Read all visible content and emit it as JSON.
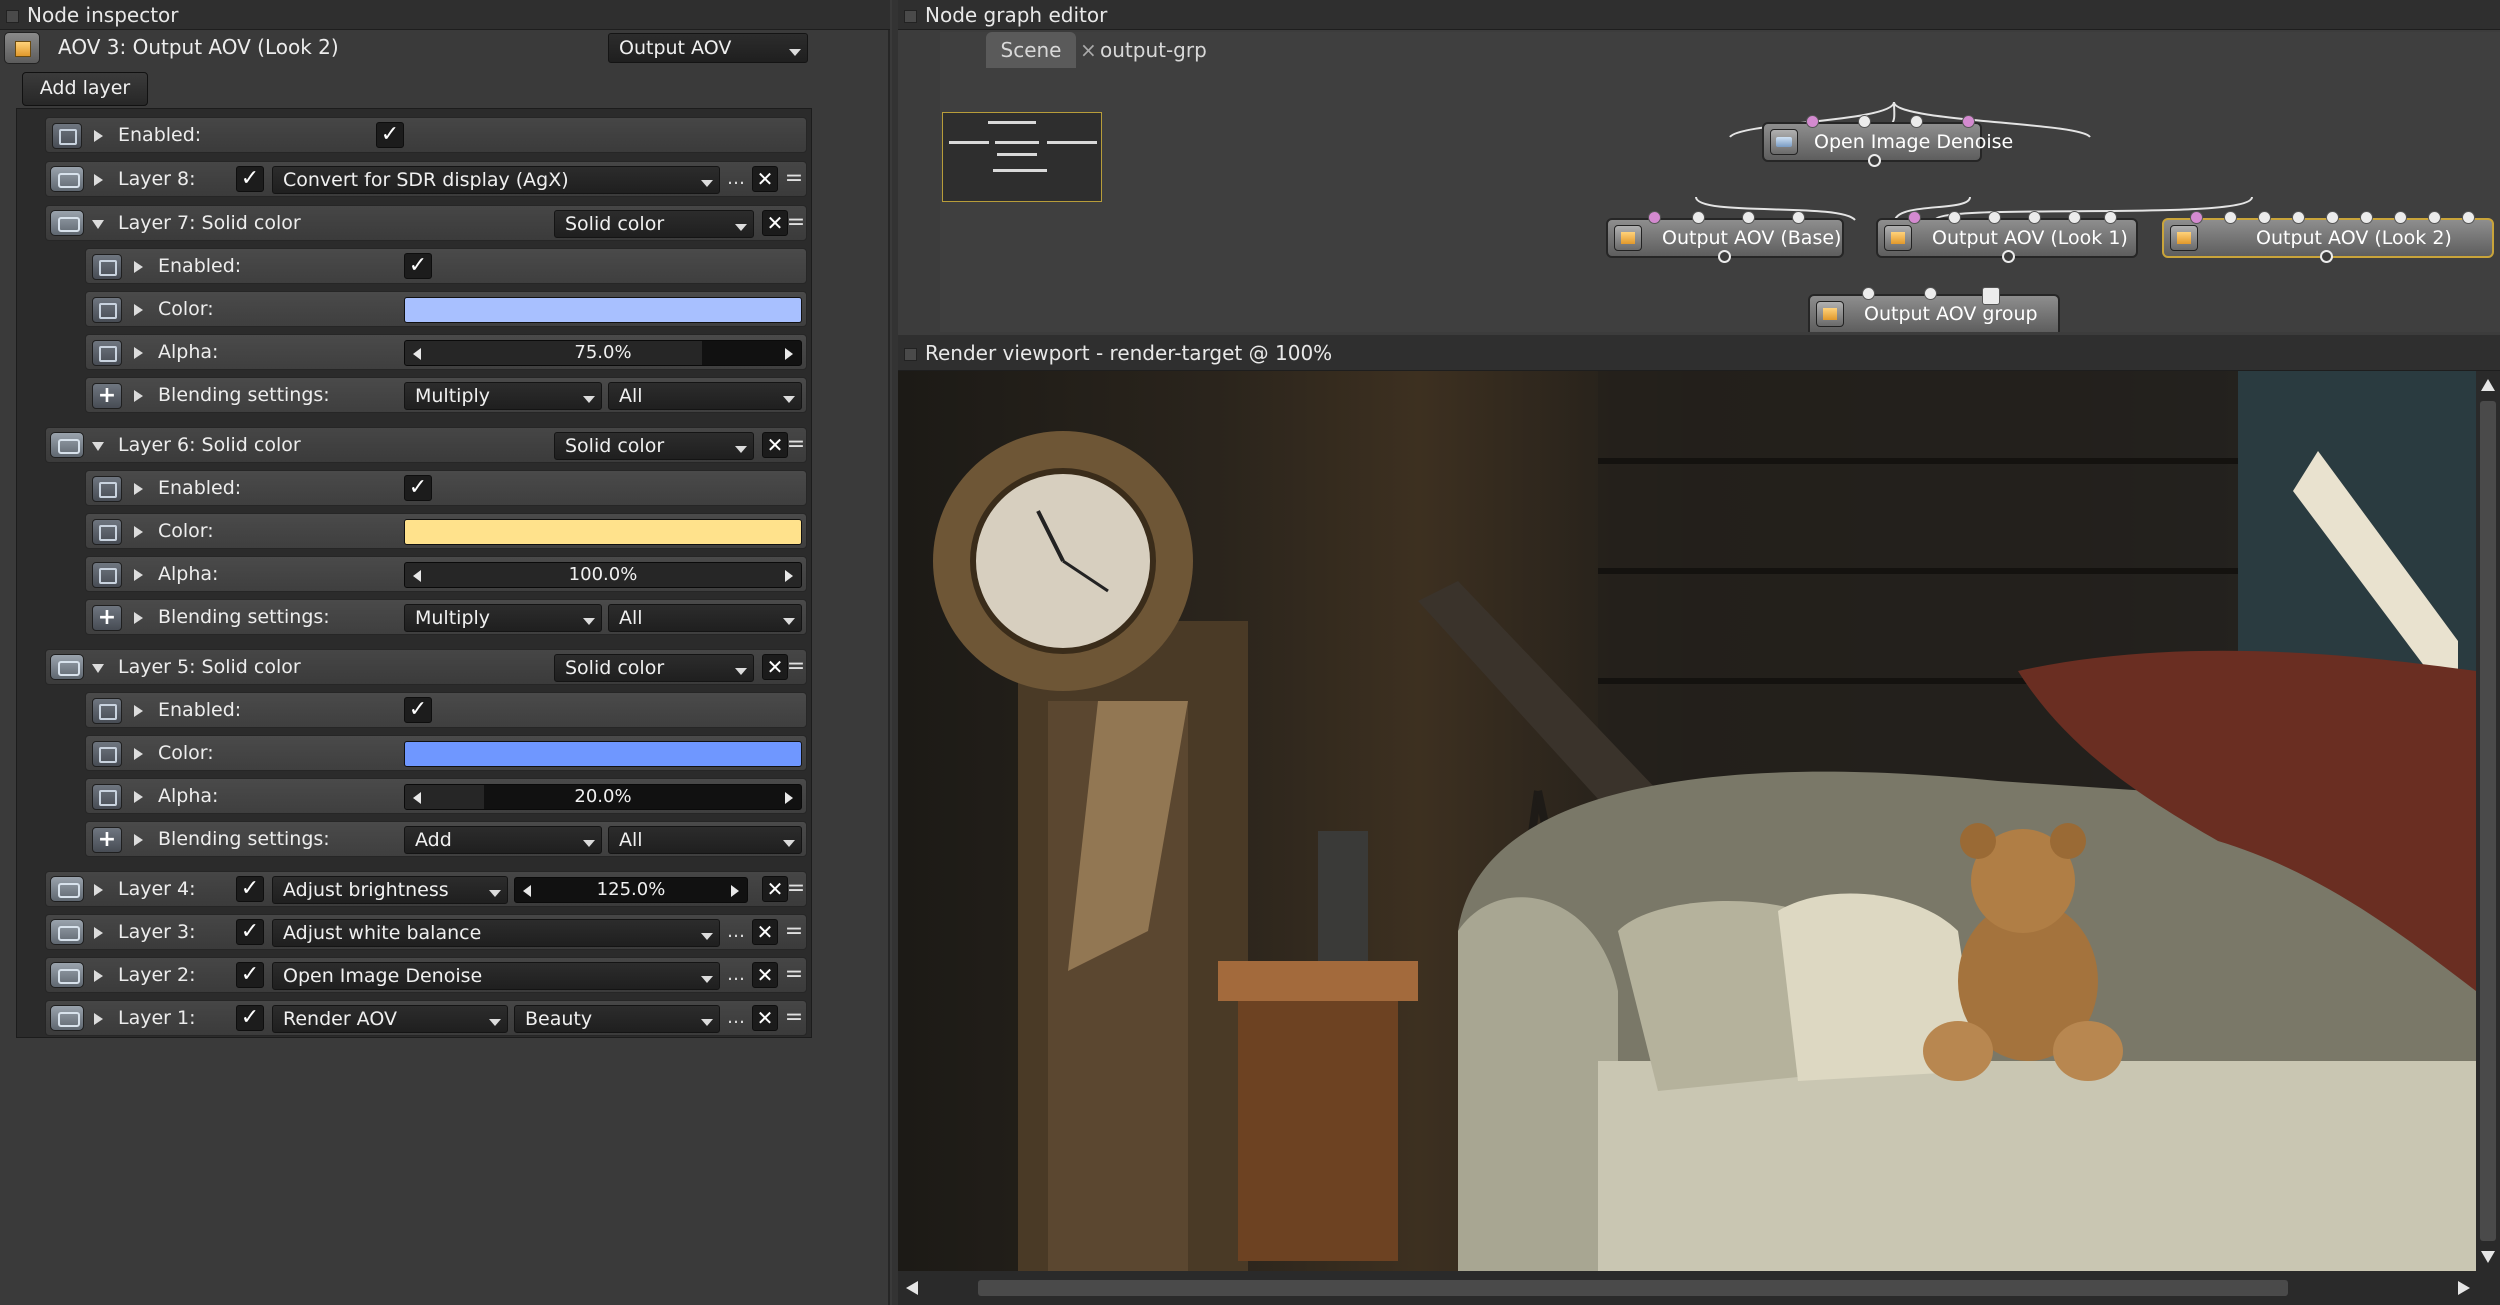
{
  "inspector": {
    "title": "Node inspector",
    "node_name": "AOV 3: Output AOV (Look 2)",
    "node_type": "Output AOV",
    "add_layer_label": "Add layer",
    "enabled_label": "Enabled:",
    "layers": [
      {
        "label": "Layer 8:",
        "value": "Convert for SDR display (AgX)"
      },
      {
        "label": "Layer 7: Solid color",
        "type": "Solid color",
        "enabled_label": "Enabled:",
        "color_label": "Color:",
        "color": "#a8c0ff",
        "alpha_label": "Alpha:",
        "alpha": "75.0%",
        "alpha_frac": 0.75,
        "blend_label": "Blending settings:",
        "blend_mode": "Multiply",
        "blend_channels": "All"
      },
      {
        "label": "Layer 6: Solid color",
        "type": "Solid color",
        "enabled_label": "Enabled:",
        "color_label": "Color:",
        "color": "#ffe28c",
        "alpha_label": "Alpha:",
        "alpha": "100.0%",
        "alpha_frac": 1.0,
        "blend_label": "Blending settings:",
        "blend_mode": "Multiply",
        "blend_channels": "All"
      },
      {
        "label": "Layer 5: Solid color",
        "type": "Solid color",
        "enabled_label": "Enabled:",
        "color_label": "Color:",
        "color": "#6f97ff",
        "alpha_label": "Alpha:",
        "alpha": "20.0%",
        "alpha_frac": 0.2,
        "blend_label": "Blending settings:",
        "blend_mode": "Add",
        "blend_channels": "All"
      },
      {
        "label": "Layer 4:",
        "value": "Adjust brightness",
        "amount": "125.0%"
      },
      {
        "label": "Layer 3:",
        "value": "Adjust white balance"
      },
      {
        "label": "Layer 2:",
        "value": "Open Image Denoise"
      },
      {
        "label": "Layer 1:",
        "value": "Render AOV",
        "value2": "Beauty"
      }
    ]
  },
  "graph": {
    "title": "Node graph editor",
    "tabs": [
      "Scene",
      "output-grp"
    ],
    "nodes": {
      "denoise": "Open Image Denoise",
      "base": "Output AOV (Base)",
      "look1": "Output AOV (Look 1)",
      "look2": "Output AOV (Look 2)",
      "group": "Output AOV group"
    }
  },
  "viewport": {
    "title": "Render viewport - render-target @ 100%"
  }
}
